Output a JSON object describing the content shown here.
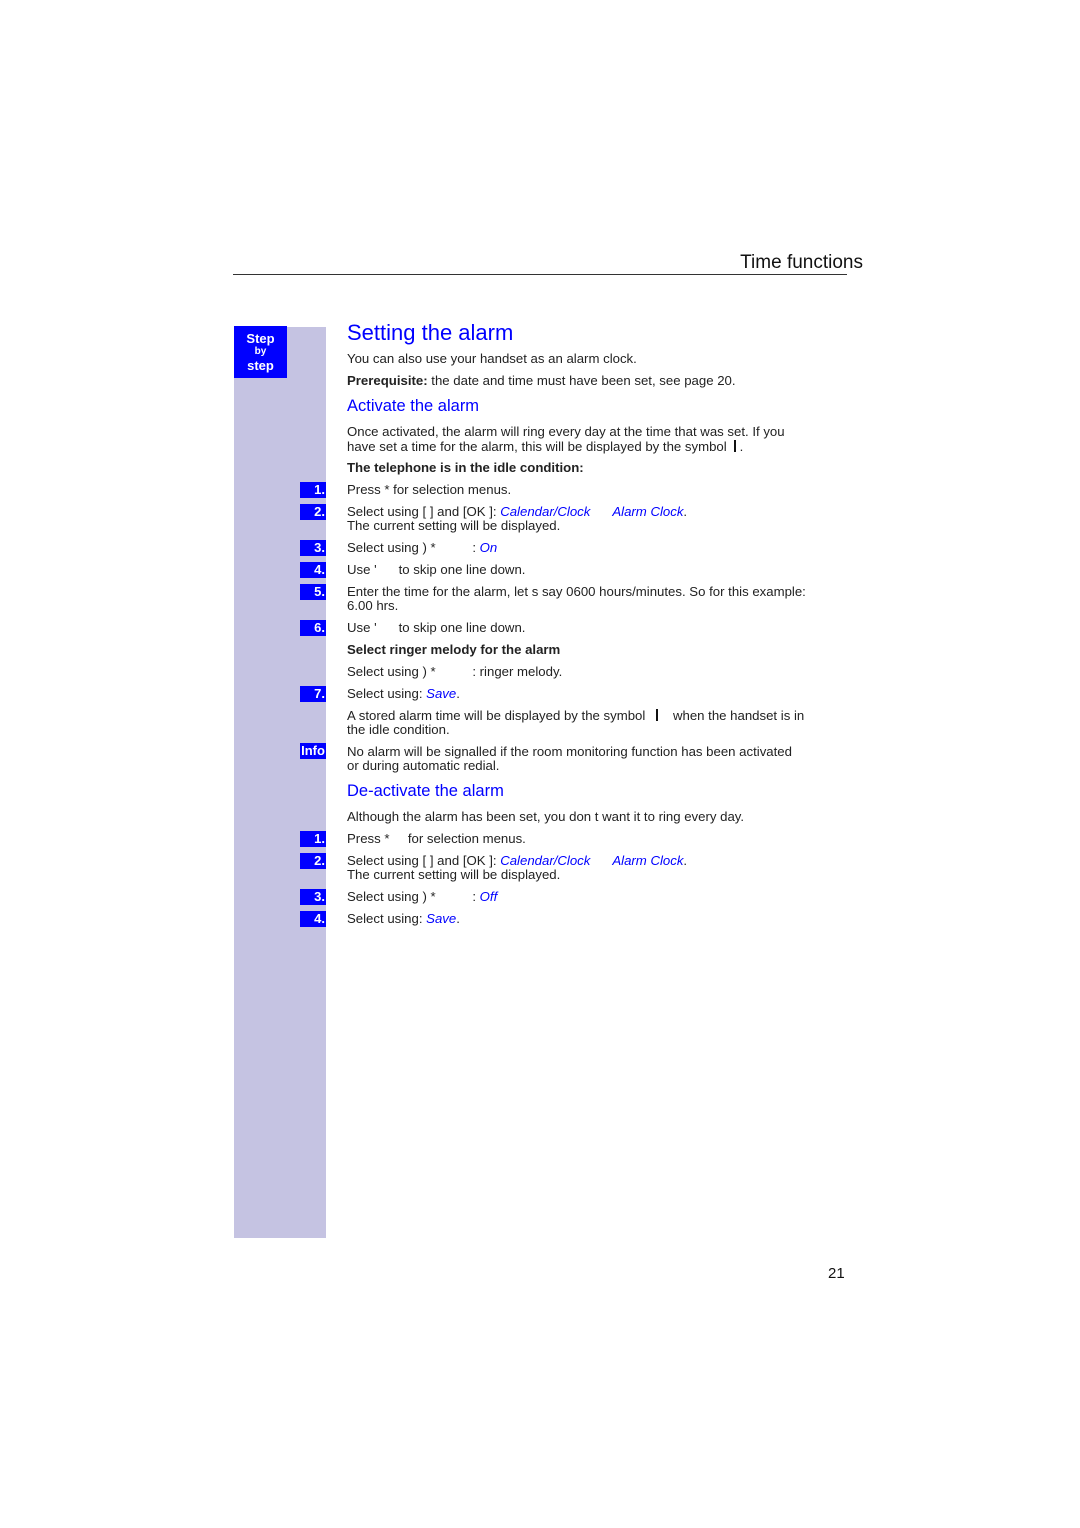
{
  "header": {
    "section_title": "Time functions"
  },
  "sidebar": {
    "badge": {
      "line1": "Step",
      "line2": "by",
      "line3": "step"
    },
    "info_label": "Info"
  },
  "title": "Setting the alarm",
  "intro": {
    "line1": "You can also use your handset as an alarm clock.",
    "prereq_label": "Prerequisite:",
    "prereq_text": " the date and time must have been set, see page 20."
  },
  "activate": {
    "heading": "Activate the alarm",
    "desc1": "Once activated, the alarm will ring every day at the time that was set. If you",
    "desc2a": "have set a time for the alarm, this will be displayed by the symbol",
    "desc2b": " .",
    "condition": "The telephone is in the idle condition:",
    "steps": [
      {
        "num": "1.",
        "text": "Press *     for selection menus."
      },
      {
        "num": "2.",
        "pre": "Select using [    ] and [OK ]: ",
        "menu1": "Calendar/Clock",
        "menu2": "Alarm Clock",
        "post": ".",
        "line2": "The current setting will be displayed."
      },
      {
        "num": "3.",
        "pre": "Select using ) *          : ",
        "value": "On"
      },
      {
        "num": "4.",
        "text": "Use '      to skip one line down."
      },
      {
        "num": "5.",
        "text": "Enter the time for the alarm, let s say 0600 hours/minutes. So for this example:",
        "line2": "6.00 hrs."
      },
      {
        "num": "6.",
        "text": "Use '      to skip one line down."
      }
    ],
    "melody_heading": "Select ringer melody for the alarm",
    "melody_text": "Select using ) *          : ringer melody.",
    "step7": {
      "num": "7.",
      "pre": "Select using: ",
      "value": "Save",
      "post": "."
    },
    "stored1a": "A stored alarm time will be displayed by the symbol",
    "stored1b": "when the handset is in",
    "stored2": "the idle condition.",
    "info1": "No alarm will be signalled if the room monitoring function has been activated",
    "info2": "or during automatic redial."
  },
  "deactivate": {
    "heading": "De-activate the alarm",
    "desc": "Although the alarm has been set, you don t want it to ring every day.",
    "steps": [
      {
        "num": "1.",
        "text": "Press *     for selection menus."
      },
      {
        "num": "2.",
        "pre": "Select using [    ] and [OK ]: ",
        "menu1": "Calendar/Clock",
        "menu2": "Alarm Clock",
        "post": ".",
        "line2": "The current setting will be displayed."
      },
      {
        "num": "3.",
        "pre": "Select using ) *          : ",
        "value": "Off"
      },
      {
        "num": "4.",
        "pre": "Select using: ",
        "value": "Save",
        "post": "."
      }
    ]
  },
  "footer": {
    "page_number": "21"
  },
  "colors": {
    "accent": "#0000ff",
    "sidebar": "#c5c3e2"
  }
}
